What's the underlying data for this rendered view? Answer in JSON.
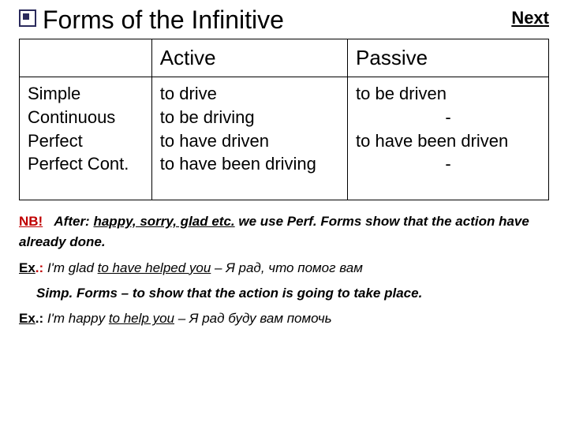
{
  "header": {
    "title": "Forms of the Infinitive",
    "next": "Next"
  },
  "table": {
    "col_active": "Active",
    "col_passive": "Passive",
    "rows": {
      "r1": "Simple",
      "r2": "Continuous",
      "r3": "Perfect",
      "r4": "Perfect Cont."
    },
    "active": {
      "r1": "to drive",
      "r2": "to be driving",
      "r3": "to have driven",
      "r4": "to have been driving"
    },
    "passive": {
      "r1": "to be driven",
      "r2": "-",
      "r3": "to have been driven",
      "r4": "-"
    }
  },
  "notes": {
    "nb_label": "NB!",
    "nb_after": "After:",
    "nb_adjs": "happy, sorry, glad etc.",
    "nb_rest": "we use Perf. Forms show that the action have already done.",
    "ex_label": "Ex",
    "ex1_dot": ".:",
    "ex1_text_a": "I'm glad ",
    "ex1_text_u": "to have helped you",
    "ex1_text_b": " – Я рад, что помог вам",
    "simp_line": "Simp. Forms – to show that the action is going to take place.",
    "ex2_dot": ".:",
    "ex2_text_a": "I'm happy ",
    "ex2_text_u": "to help you",
    "ex2_text_b": " – Я рад буду вам помочь"
  }
}
